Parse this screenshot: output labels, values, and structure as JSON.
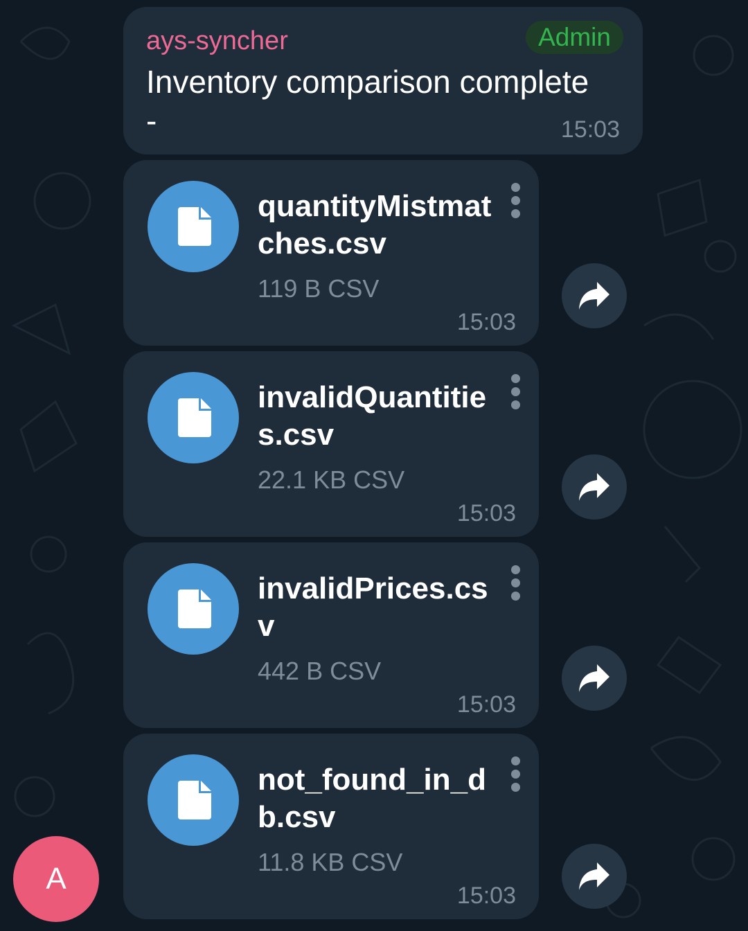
{
  "message": {
    "sender": "ays-syncher",
    "badge": "Admin",
    "text": "Inventory comparison complete\n-",
    "time": "15:03"
  },
  "files": [
    {
      "name": "quantityMistmatches.csv",
      "meta": "119 B CSV",
      "time": "15:03"
    },
    {
      "name": "invalidQuantities.csv",
      "meta": "22.1 KB CSV",
      "time": "15:03"
    },
    {
      "name": "invalidPrices.csv",
      "meta": "442 B CSV",
      "time": "15:03"
    },
    {
      "name": "not_found_in_db.csv",
      "meta": "11.8 KB CSV",
      "time": "15:03"
    }
  ],
  "avatar": {
    "initial": "A"
  },
  "colors": {
    "background": "#101a24",
    "bubble": "#1f2c3a",
    "sender": "#ec6a94",
    "admin_badge": "#34b44e",
    "file_icon": "#4a97d6",
    "avatar": "#eb5a79",
    "muted_text": "#7f8c99"
  },
  "icons": [
    "file-icon",
    "more-vertical-icon",
    "share-arrow-icon"
  ]
}
